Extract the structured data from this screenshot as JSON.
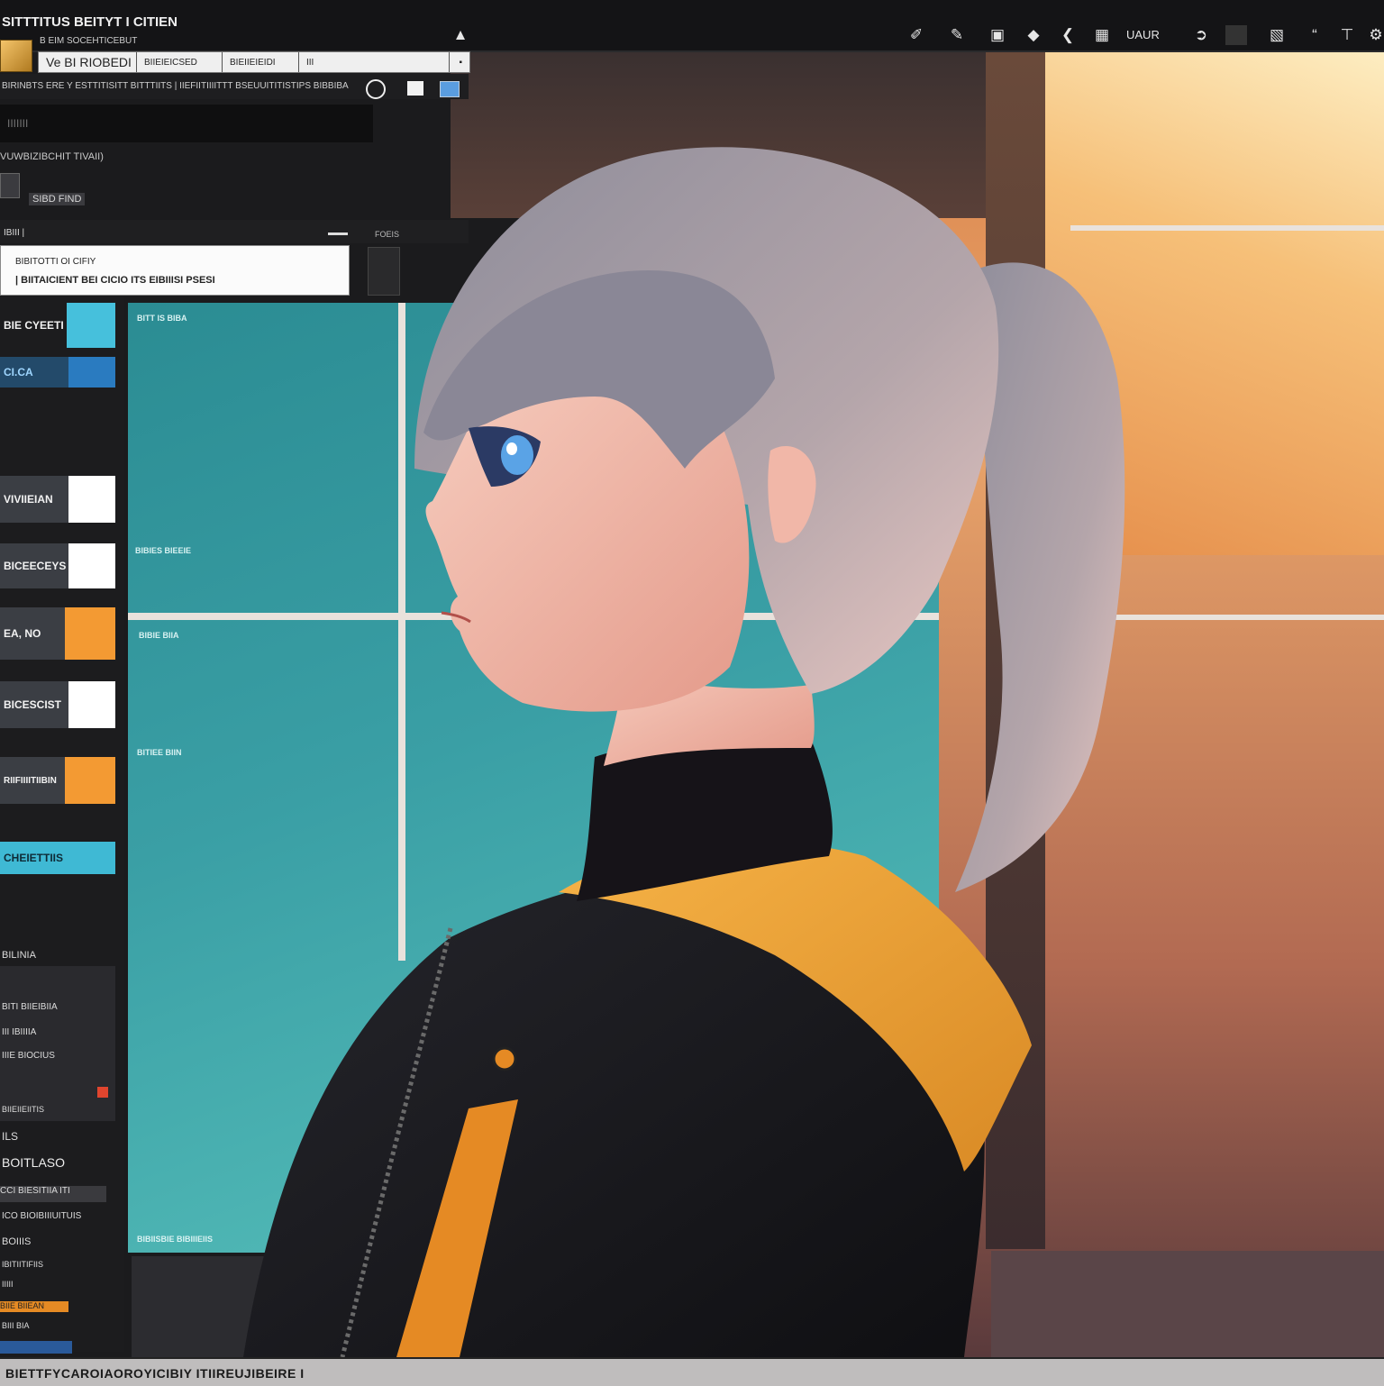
{
  "app": {
    "title": "SITTTITUS BEITYT I CITIEN",
    "subtitle": "B EIM SOCEHTICEBUT"
  },
  "toolbar": {
    "label": "UAUR",
    "tools": [
      "brush-icon",
      "pen-icon",
      "frame-icon",
      "fill-icon",
      "back-icon",
      "grid-icon",
      "lasso-icon",
      "color-icon",
      "layer-icon",
      "text-icon",
      "transform-icon",
      "settings-icon"
    ]
  },
  "tabs": [
    {
      "label": "Ve BI RIOBEDI"
    },
    {
      "label": "BIIEIEICSED"
    },
    {
      "label": "BIEIIEIEIDI"
    },
    {
      "label": "III"
    }
  ],
  "breadcrumb": "BIRINBTS ERE   Y  ESTTITISITT BITTTIITS   |   IIEFIITIIIITTT BSEUUITITISTIPS BIBBIBA",
  "search": {
    "placeholder": "IIIIIII"
  },
  "panel": {
    "line1": "VUWBIZIBCHIT TIVAII)",
    "line2": "SIBD FIND",
    "header_left": "IBIII |",
    "header_right": "FOEIS",
    "dialog_line1": "BIBITOTTI OI CIFIY",
    "dialog_line2": "| BIITAICIENT BEI CICIO ITS EIBIIISI PSESI"
  },
  "sidebar": {
    "items": [
      {
        "label": "BIE CYEETI",
        "swatch": "#46c0dc"
      },
      {
        "label": "CI.CA",
        "swatch": "#2a7bc0"
      },
      {
        "label": "VIVIIEIAN",
        "swatch": "#ffffff"
      },
      {
        "label": "BICEECEYS",
        "swatch": "#ffffff"
      },
      {
        "label": "EA, NO",
        "swatch": "#f39a33"
      },
      {
        "label": "BICESCIST",
        "swatch": "#ffffff"
      },
      {
        "label": "RIIFIIIITIIBIN",
        "swatch": "#f39a33"
      },
      {
        "label": "CHEIETTIIS",
        "swatch": "#3fb9d4"
      }
    ],
    "lower": [
      "BILINIA",
      "BITI BIIEIBIIA",
      "III IBIIIIA",
      "IIIE BIOCIUS",
      "BIIEIIEIITIS",
      "ILS",
      "BOITLASO",
      "CCI BIESITIIA ITI",
      "ICO BIOIBIIIUITUIS",
      "BOIIIS",
      "IBITIITIFIIS",
      "IIIII",
      "BIIE BIIEAN",
      "BIII BIA"
    ]
  },
  "canvas": {
    "labels": [
      "BITT IS BIBA",
      "BIBIES BIEEIE",
      "BIBIE BIIA",
      "BITIEE BIIN",
      "BIBIISBIE BIBIIIEIIS"
    ]
  },
  "status": {
    "text": "BIETTFYCAROIAOROYICIBIY ITIIREUJIBEIRE I"
  },
  "colors": {
    "accent": "#f39a33",
    "teal": "#3a9fa5",
    "bg": "#1b1b1d"
  }
}
